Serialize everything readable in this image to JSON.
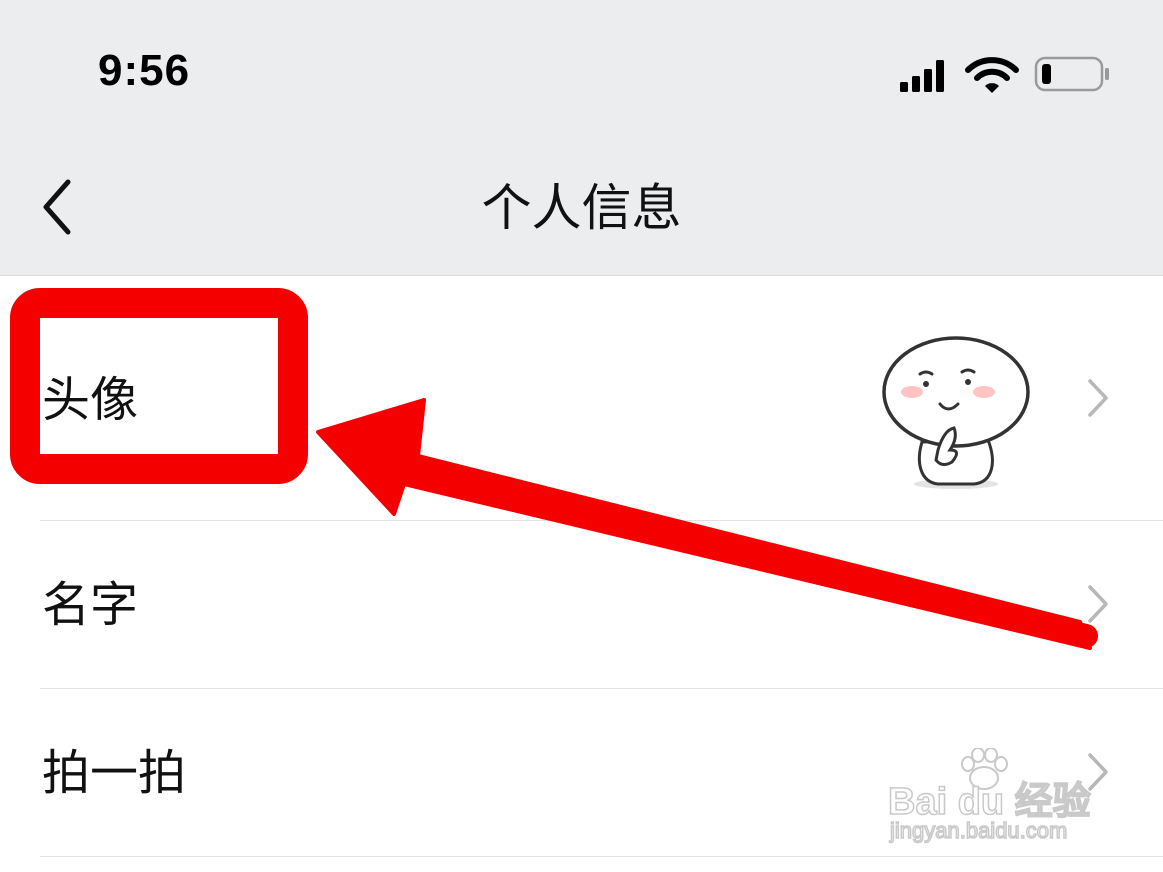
{
  "status_bar": {
    "time": "9:56",
    "icons": [
      "cellular-signal-icon",
      "wifi-icon",
      "battery-icon"
    ],
    "battery_level": 0.15
  },
  "nav": {
    "title": "个人信息",
    "back_icon": "chevron-left-icon"
  },
  "rows": [
    {
      "label": "头像",
      "value": "",
      "icon": "chevron-right-icon"
    },
    {
      "label": "名字",
      "value": "",
      "icon": "chevron-right-icon"
    },
    {
      "label": "拍一拍",
      "value": "",
      "icon": "chevron-right-icon"
    }
  ],
  "annotation": {
    "highlight_color": "#f50000",
    "arrow_color": "#f50000"
  },
  "watermark": {
    "brand": "Bai du 经验",
    "url": "jingyan.baidu.com"
  },
  "colors": {
    "header_bg": "#ebedee",
    "row_bg": "#ffffff",
    "divider": "#e2e2e2"
  }
}
